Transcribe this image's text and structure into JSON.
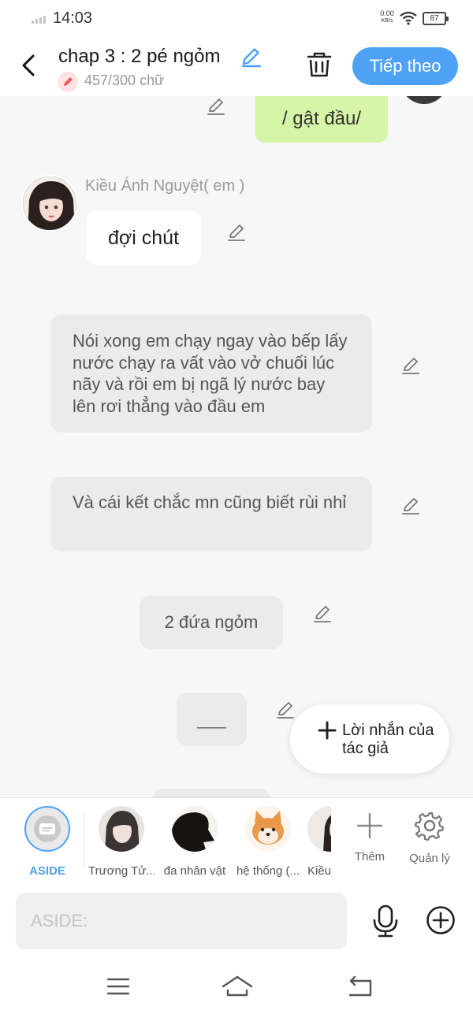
{
  "status_bar": {
    "time": "14:03",
    "net_speed_value": "0.00",
    "net_speed_unit": "KB/s",
    "battery": "87"
  },
  "header": {
    "title": "chap 3 : 2 pé ngỏm",
    "word_count": "457/300 chữ",
    "next_button": "Tiếp theo"
  },
  "messages": {
    "action_text": "/ gật đầu/",
    "sender_name": "Kiều Ánh Nguyệt( em )",
    "sender_message": "đợi chút",
    "narration_1": "Nói xong em chạy ngay vào bếp lấy nước chạy ra vất vào vở chuối lúc nãy và rồi em bị ngã lý nước bay lên rơi thẳng vào đầu em",
    "narration_2": "Và cái kết chắc mn cũng biết rùi nhỉ",
    "narration_3": "2 đứa ngỏm",
    "narration_4": "___"
  },
  "author_note_button": "Lời nhắn của tác giả",
  "characters": [
    {
      "name": "ASIDE"
    },
    {
      "name": "Trương Tử..."
    },
    {
      "name": "đa nhân vật"
    },
    {
      "name": "hệ thống (..."
    },
    {
      "name": "Kiều..."
    }
  ],
  "tools": {
    "add_label": "Thêm",
    "manage_label": "Quản lý"
  },
  "input": {
    "placeholder": "ASIDE:"
  },
  "colors": {
    "accent": "#4ea2f5",
    "action_bubble": "#d6f5a6",
    "narration_bubble": "#ebebeb"
  }
}
